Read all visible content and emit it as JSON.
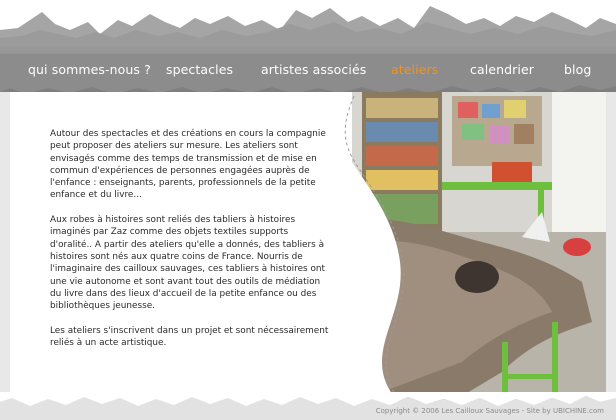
{
  "nav": {
    "items": [
      {
        "label": "qui sommes-nous ?",
        "active": false
      },
      {
        "label": "spectacles",
        "active": false
      },
      {
        "label": "artistes associés",
        "active": false
      },
      {
        "label": "ateliers",
        "active": true
      },
      {
        "label": "calendrier",
        "active": false
      },
      {
        "label": "blog",
        "active": false
      }
    ]
  },
  "main": {
    "paragraphs": [
      "Autour des spectacles et des créations en cours la compagnie peut proposer des ateliers sur mesure. Les ateliers sont envisagés comme des temps de transmission et de mise en commun d'expériences de personnes engagées auprès de l'enfance : enseignants, parents, professionnels de la petite enfance et du livre...",
      "Aux robes à histoires sont reliés des tabliers à histoires imaginés par Zaz comme des objets textiles supports d'oralité.. A partir des ateliers qu'elle a donnés, des tabliers à histoires sont nés aux quatre coins de France. Nourris de l'imaginaire des cailloux sauvages, ces tabliers à histoires ont  une vie autonome et sont avant tout des outils de médiation du livre dans des lieux d'accueil de la petite enfance ou des bibliothèques jeunesse.",
      "Les ateliers s'inscrivent dans un projet et sont nécessairement reliés à un acte artistique."
    ]
  },
  "footer": {
    "copyright": "Copyright © 2006  Les Cailloux Sauvages  -  Site by UBICHINE.com"
  },
  "colors": {
    "nav_band": "#8f8f8f",
    "active_nav": "#f0941e",
    "text": "#2a2a2a"
  }
}
